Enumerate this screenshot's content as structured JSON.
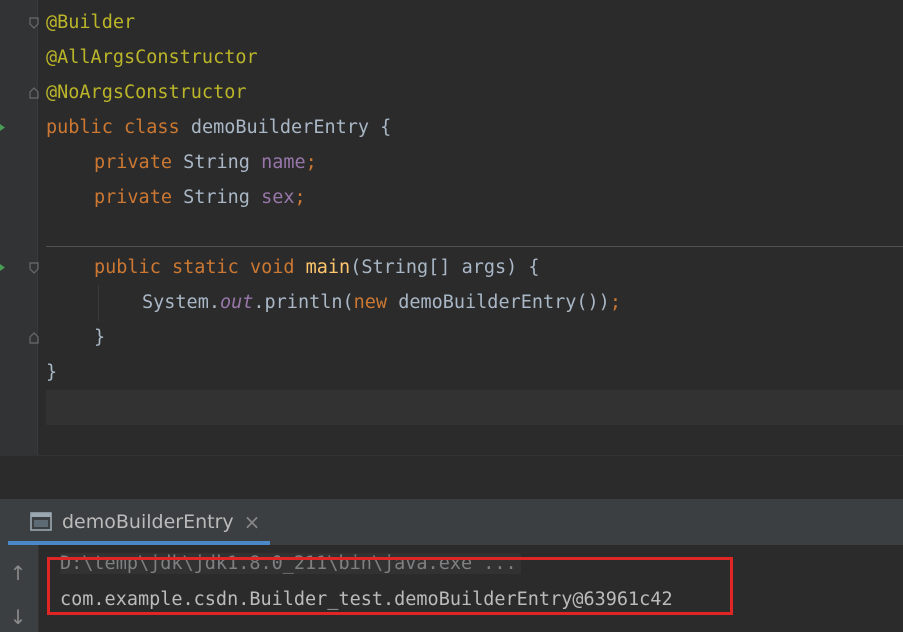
{
  "editor": {
    "lines": {
      "l1": {
        "ann": "@Builder"
      },
      "l2": {
        "ann": "@AllArgsConstructor"
      },
      "l3": {
        "ann": "@NoArgsConstructor"
      },
      "l4": {
        "kw1": "public",
        "kw2": "class",
        "name": "demoBuilderEntry",
        "brace": " {"
      },
      "l5": {
        "kw": "private",
        "type": "String",
        "field": "name",
        "semi": ";"
      },
      "l6": {
        "kw": "private",
        "type": "String",
        "field": "sex",
        "semi": ";"
      },
      "l8": {
        "kw1": "public",
        "kw2": "static",
        "kw3": "void",
        "fn": "main",
        "args": "(String[] args) {"
      },
      "l9": {
        "sys": "System.",
        "out": "out",
        "call": ".println(",
        "kw": "new",
        "ctor": " demoBuilderEntry())",
        "semi": ";"
      },
      "l10": {
        "brace": "}"
      },
      "l11": {
        "brace": "}"
      }
    }
  },
  "run_panel": {
    "tab_label": "demoBuilderEntry",
    "close": "×",
    "icons": {
      "tab": "console-window-icon",
      "up": "arrow-up-icon",
      "down": "arrow-down-icon"
    },
    "console": {
      "command": "D:\\temp\\jdk\\jdk1.8.0_211\\bin\\java.exe ...",
      "output": "com.example.csdn.Builder_test.demoBuilderEntry@63961c42"
    }
  },
  "colors": {
    "highlight_box": "#e02525",
    "accent": "#4a88c7"
  }
}
